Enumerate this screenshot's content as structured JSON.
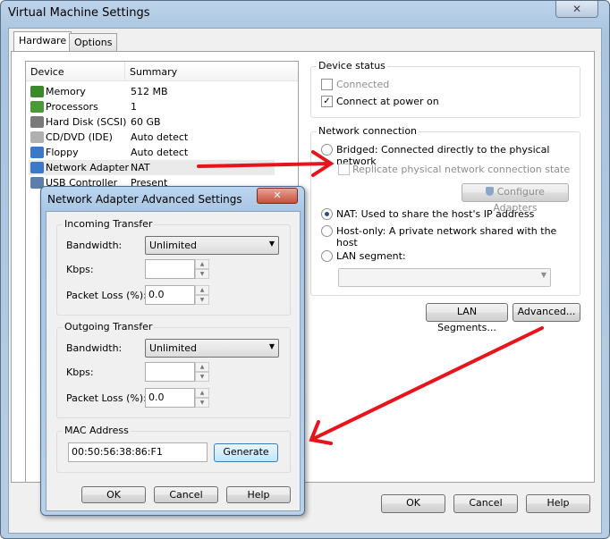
{
  "window": {
    "title": "Virtual Machine Settings",
    "close": "✕"
  },
  "tabs": [
    {
      "label": "Hardware",
      "active": true
    },
    {
      "label": "Options",
      "active": false
    }
  ],
  "device_list": {
    "columns": [
      "Device",
      "Summary"
    ],
    "rows": [
      {
        "device": "Memory",
        "summary": "512 MB",
        "icon": "memory-icon",
        "color": "#3a8a2a"
      },
      {
        "device": "Processors",
        "summary": "1",
        "icon": "processor-icon",
        "color": "#4a9a3a"
      },
      {
        "device": "Hard Disk (SCSI)",
        "summary": "60 GB",
        "icon": "hard-disk-icon",
        "color": "#7a7a7a"
      },
      {
        "device": "CD/DVD (IDE)",
        "summary": "Auto detect",
        "icon": "cd-dvd-icon",
        "color": "#b0b0b0"
      },
      {
        "device": "Floppy",
        "summary": "Auto detect",
        "icon": "floppy-icon",
        "color": "#3a78c8"
      },
      {
        "device": "Network Adapter",
        "summary": "NAT",
        "icon": "network-adapter-icon",
        "color": "#3a78c8",
        "selected": true
      },
      {
        "device": "USB Controller",
        "summary": "Present",
        "icon": "usb-icon",
        "color": "#5a7fa8"
      }
    ]
  },
  "device_status": {
    "label": "Device status",
    "connected": {
      "label": "Connected",
      "checked": false,
      "disabled": true
    },
    "connect_at_power_on": {
      "label": "Connect at power on",
      "checked": true
    }
  },
  "network_connection": {
    "label": "Network connection",
    "bridged": {
      "label": "Bridged: Connected directly to the physical network",
      "selected": false
    },
    "replicate": {
      "label": "Replicate physical network connection state",
      "checked": false,
      "disabled": true
    },
    "configure_adapters": "Configure Adapters",
    "nat": {
      "label": "NAT: Used to share the host's IP address",
      "selected": true
    },
    "host_only": {
      "label": "Host-only: A private network shared with the host",
      "selected": false
    },
    "lan_segment": {
      "label": "LAN segment:",
      "selected": false,
      "value": ""
    }
  },
  "buttons": {
    "lan_segments": "LAN Segments...",
    "advanced": "Advanced...",
    "ok": "OK",
    "cancel": "Cancel",
    "help": "Help"
  },
  "dialog": {
    "title": "Network Adapter Advanced Settings",
    "close": "✕",
    "incoming": {
      "label": "Incoming Transfer",
      "bandwidth_label": "Bandwidth:",
      "bandwidth": "Unlimited",
      "kbps_label": "Kbps:",
      "kbps": "",
      "loss_label": "Packet Loss (%):",
      "loss": "0.0"
    },
    "outgoing": {
      "label": "Outgoing Transfer",
      "bandwidth_label": "Bandwidth:",
      "bandwidth": "Unlimited",
      "kbps_label": "Kbps:",
      "kbps": "",
      "loss_label": "Packet Loss (%):",
      "loss": "0.0"
    },
    "mac": {
      "label": "MAC Address",
      "value": "00:50:56:38:86:F1",
      "generate": "Generate"
    },
    "ok": "OK",
    "cancel": "Cancel",
    "help": "Help"
  },
  "annotation_color": "#e8141c"
}
